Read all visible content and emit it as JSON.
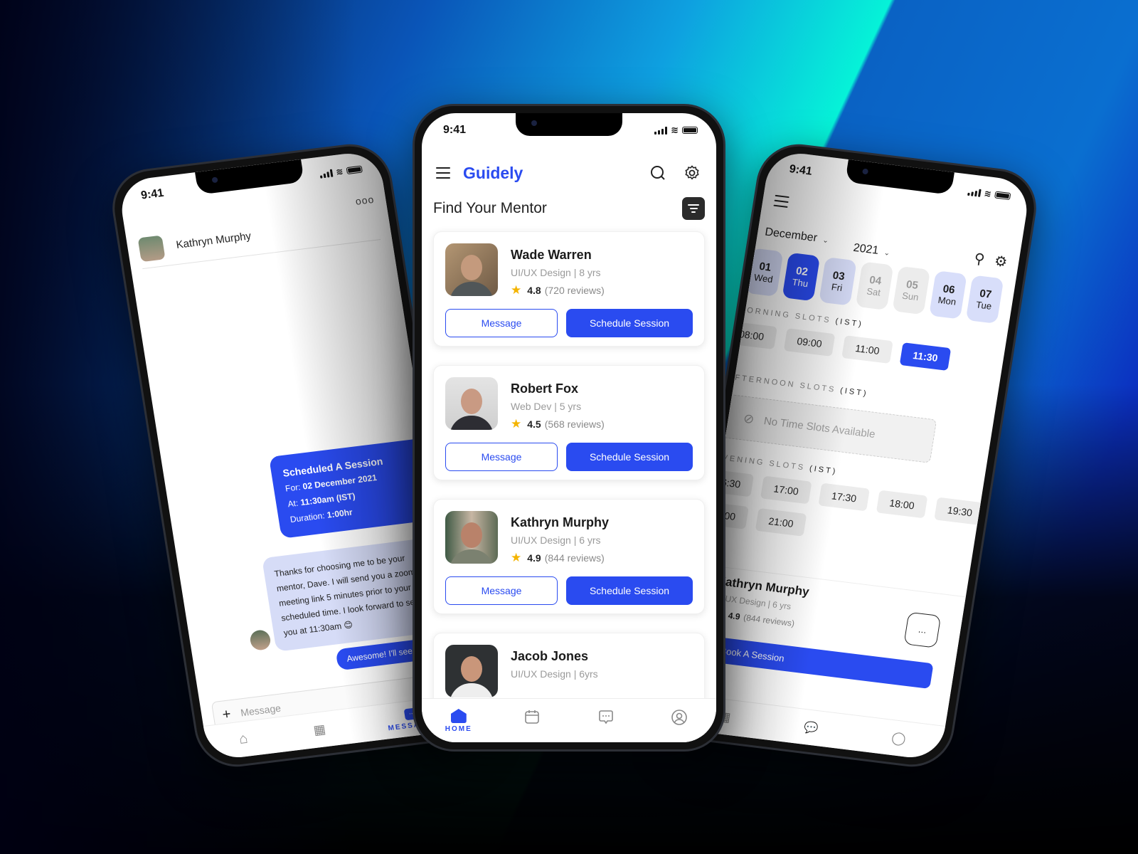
{
  "center": {
    "status_time": "9:41",
    "brand": "Guidely",
    "page_title": "Find Your Mentor",
    "mentors": [
      {
        "name": "Wade Warren",
        "role": "UI/UX Design | 8 yrs",
        "rating": "4.8",
        "reviews": "(720 reviews)",
        "message_label": "Message",
        "schedule_label": "Schedule Session"
      },
      {
        "name": "Robert Fox",
        "role": "Web Dev | 5 yrs",
        "rating": "4.5",
        "reviews": "(568 reviews)",
        "message_label": "Message",
        "schedule_label": "Schedule Session"
      },
      {
        "name": "Kathryn Murphy",
        "role": "UI/UX Design | 6 yrs",
        "rating": "4.9",
        "reviews": "(844 reviews)",
        "message_label": "Message",
        "schedule_label": "Schedule Session"
      },
      {
        "name": "Jacob Jones",
        "role": "UI/UX Design | 6yrs"
      }
    ],
    "tabs": [
      {
        "label": "HOME",
        "icon": "home-icon",
        "active": true
      },
      {
        "label": "",
        "icon": "calendar-icon"
      },
      {
        "label": "",
        "icon": "chat-icon"
      },
      {
        "label": "",
        "icon": "profile-icon"
      }
    ]
  },
  "chat": {
    "status_time": "9:41",
    "contact_name": "Kathryn Murphy",
    "more": "ooo",
    "scheduled": {
      "title": "Scheduled A Session",
      "for_label": "For:",
      "for_value": "02 December 2021",
      "at_label": "At:",
      "at_value": "11:30am (IST)",
      "duration_label": "Duration:",
      "duration_value": "1:00hr"
    },
    "received_message": "Thanks for choosing me to be your mentor, Dave. I will send you a zoom meeting link 5 minutes prior to your scheduled time. I look forward to seeing you at 11:30am 😊",
    "sent_message": "Awesome! I'll see you at",
    "input_placeholder": "Message",
    "active_tab": "MESSAGES"
  },
  "schedule": {
    "status_time": "9:41",
    "month": "December",
    "year": "2021",
    "dates": [
      {
        "day": "01",
        "weekday": "Wed",
        "state": "avail"
      },
      {
        "day": "02",
        "weekday": "Thu",
        "state": "sel"
      },
      {
        "day": "03",
        "weekday": "Fri",
        "state": "avail"
      },
      {
        "day": "04",
        "weekday": "Sat",
        "state": "na"
      },
      {
        "day": "05",
        "weekday": "Sun",
        "state": "na"
      },
      {
        "day": "06",
        "weekday": "Mon",
        "state": "avail"
      },
      {
        "day": "07",
        "weekday": "Tue",
        "state": "avail"
      }
    ],
    "morning_label": "MORNING SLOTS",
    "afternoon_label": "AFTERNOON SLOTS",
    "evening_label": "EVENING SLOTS",
    "tz": "(IST)",
    "morning_slots": [
      "08:00",
      "09:00",
      "11:00",
      "11:30"
    ],
    "selected_slot": "11:30",
    "no_slots_text": "No Time Slots Available",
    "evening_slots": [
      "16:30",
      "17:00",
      "17:30",
      "18:00",
      "19:30",
      "20:00",
      "21:00"
    ],
    "mentor": {
      "name": "Kathryn Murphy",
      "role": "UI/UX Design | 6 yrs",
      "rating": "4.9",
      "reviews": "(844 reviews)"
    },
    "book_label": "Book A Session"
  },
  "colors": {
    "accent": "#2a4bf0",
    "star": "#f4b400",
    "avail": "#d8defa"
  }
}
